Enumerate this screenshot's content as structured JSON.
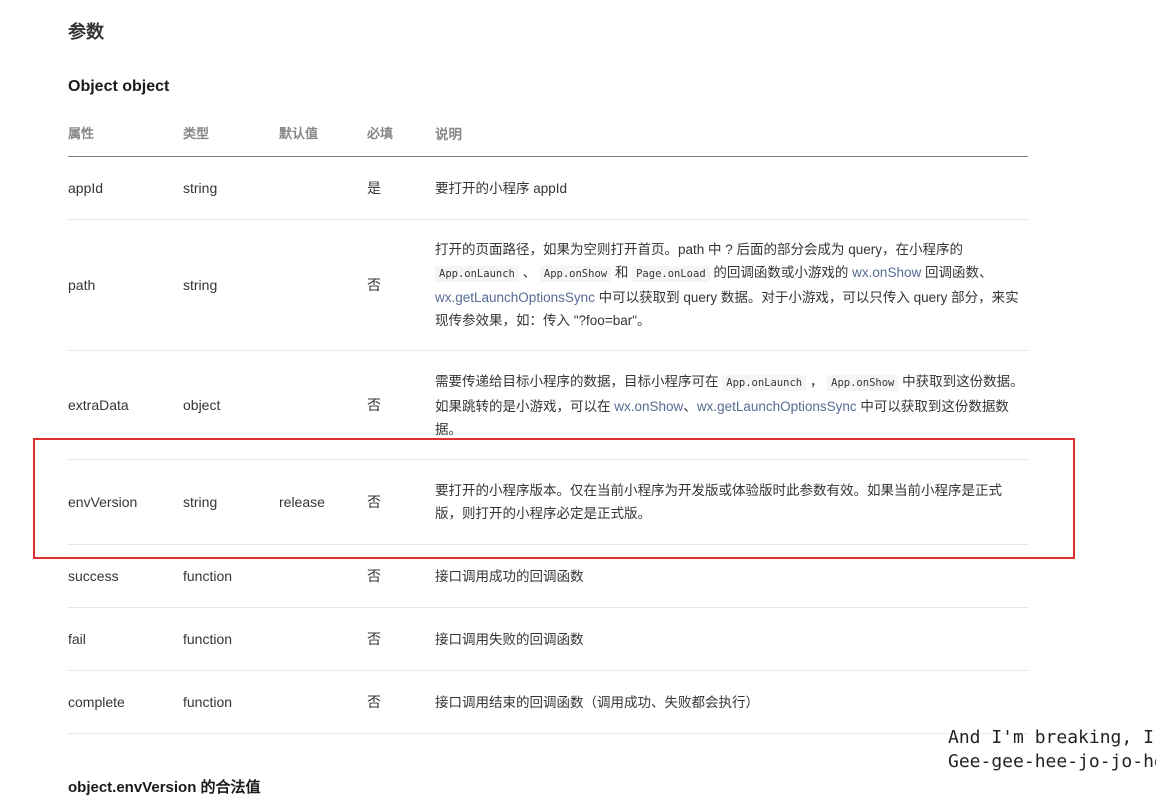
{
  "heading_params": "参数",
  "heading_object": "Object object",
  "columns": [
    "属性",
    "类型",
    "默认值",
    "必填",
    "说明"
  ],
  "rows": [
    {
      "name": "appId",
      "type": "string",
      "default": "",
      "required": "是",
      "desc": [
        {
          "t": "要打开的小程序 appId"
        }
      ]
    },
    {
      "name": "path",
      "type": "string",
      "default": "",
      "required": "否",
      "desc": [
        {
          "t": "打开的页面路径，如果为空则打开首页。path 中 ? 后面的部分会成为 query，在小程序的 "
        },
        {
          "code": "App.onLaunch"
        },
        {
          "t": " 、 "
        },
        {
          "code": "App.onShow"
        },
        {
          "t": " 和 "
        },
        {
          "code": "Page.onLoad"
        },
        {
          "t": " 的回调函数或小游戏的 "
        },
        {
          "link": "wx.onShow"
        },
        {
          "t": " 回调函数、"
        },
        {
          "link": "wx.getLaunchOptionsSync"
        },
        {
          "t": " 中可以获取到 query 数据。对于小游戏，可以只传入 query 部分，来实现传参效果，如：传入 \"?foo=bar\"。"
        }
      ]
    },
    {
      "name": "extraData",
      "type": "object",
      "default": "",
      "required": "否",
      "desc": [
        {
          "t": "需要传递给目标小程序的数据，目标小程序可在 "
        },
        {
          "code": "App.onLaunch"
        },
        {
          "t": " ， "
        },
        {
          "code": "App.onShow"
        },
        {
          "t": " 中获取到这份数据。如果跳转的是小游戏，可以在 "
        },
        {
          "link": "wx.onShow"
        },
        {
          "t": "、"
        },
        {
          "link": "wx.getLaunchOptionsSync"
        },
        {
          "t": " 中可以获取到这份数据数据。"
        }
      ]
    },
    {
      "name": "envVersion",
      "type": "string",
      "default": "release",
      "required": "否",
      "desc": [
        {
          "t": "要打开的小程序版本。仅在当前小程序为开发版或体验版时此参数有效。如果当前小程序是正式版，则打开的小程序必定是正式版。"
        }
      ]
    },
    {
      "name": "success",
      "type": "function",
      "default": "",
      "required": "否",
      "desc": [
        {
          "t": "接口调用成功的回调函数"
        }
      ]
    },
    {
      "name": "fail",
      "type": "function",
      "default": "",
      "required": "否",
      "desc": [
        {
          "t": "接口调用失败的回调函数"
        }
      ]
    },
    {
      "name": "complete",
      "type": "function",
      "default": "",
      "required": "否",
      "desc": [
        {
          "t": "接口调用结束的回调函数（调用成功、失败都会执行）"
        }
      ]
    }
  ],
  "heading_env": "object.envVersion 的合法值",
  "subtitle_lines": [
    "And I'm breaking, I'm",
    "Gee-gee-hee-jo-jo-ho-la"
  ],
  "colors": {
    "highlight": "#e02f2f",
    "link": "#576b95"
  }
}
